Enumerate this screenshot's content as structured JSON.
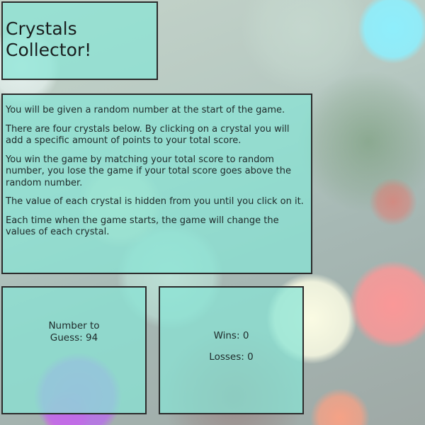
{
  "title": {
    "line1": "Crystals",
    "line2": "Collector!"
  },
  "instructions": [
    "You will be given a random number at the start of the game.",
    "There are four crystals below. By clicking on a crystal you will add a specific amount of points to your total score.",
    "You win the game by matching your total score to random number, you lose the game if your total score goes above the random number.",
    "The value of each crystal is hidden from you until you click on it.",
    "Each time when the game starts, the game will change the values of each crystal."
  ],
  "target": {
    "label": "Number to Guess:",
    "value": "94"
  },
  "score": {
    "wins_label": "Wins:",
    "wins": "0",
    "losses_label": "Losses:",
    "losses": "0"
  }
}
